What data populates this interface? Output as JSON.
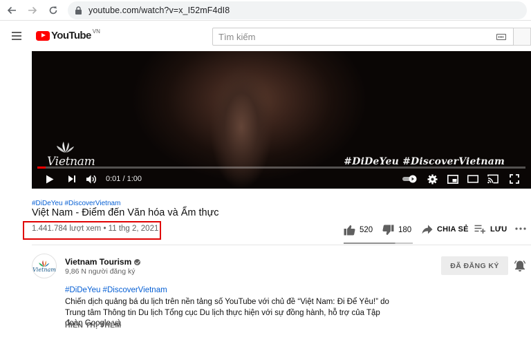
{
  "browser": {
    "url": "youtube.com/watch?v=x_I52mF4dI8"
  },
  "header": {
    "logo_text": "YouTube",
    "country_code": "VN",
    "search_placeholder": "Tìm kiếm"
  },
  "player": {
    "overlay_hashtags": "#DiDeYeu  #DiscoverVietnam",
    "watermark_text": "Vietnam",
    "time": "0:01 / 1:00",
    "progress": 0.017,
    "accent_color": "#ff0000"
  },
  "video": {
    "hashtags": "#DiDeYeu #DiscoverVietnam",
    "title": "Việt Nam - Điểm đến Văn hóa và Ẩm thực",
    "stats": "1.441.784 lượt xem • 11 thg 2, 2021",
    "likes": "520",
    "dislikes": "180",
    "share_label": "CHIA SẺ",
    "save_label": "LƯU",
    "like_ratio": 0.743
  },
  "channel": {
    "name": "Vietnam Tourism",
    "subscribers": "9,86 N người đăng ký",
    "subscribed_label": "ĐÃ ĐĂNG KÝ",
    "avatar_text": "Vietnam"
  },
  "description": {
    "hashtags": "#DiDeYeu #DiscoverVietnam",
    "text": "Chiến dịch quảng bá du lịch trên nền tảng số YouTube với chủ đề “Việt Nam: Đi Để Yêu!” do Trung tâm Thông tin Du lịch Tổng cục Du lịch thực hiện với sự đồng hành, hỗ trợ của Tập đoàn Google và",
    "show_more": "HIỂN THỊ THÊM"
  }
}
